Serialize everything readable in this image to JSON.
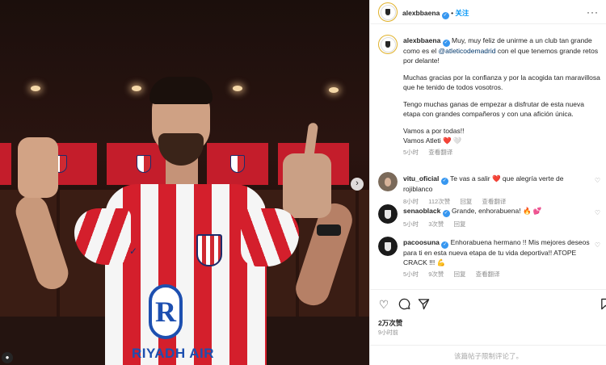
{
  "post": {
    "author": "alexbbaena",
    "follow_label": "关注",
    "more_label": "···",
    "next_label": "›",
    "tag_label": "●"
  },
  "caption": {
    "author": "alexbbaena",
    "para1_a": " Muy, muy feliz de unirme a un club tan grande como es el ",
    "mention": "@atleticodemadrid",
    "para1_b": " con el que tenemos grande retos por delante!",
    "para2": "Muchas gracias por la confianza y por la acogida tan maravillosa que he tenido de todos vosotros.",
    "para3": "Tengo muchas ganas de empezar a disfrutar de esta nueva etapa con grandes compañeros y con una afición única.",
    "para4_line1": "Vamos a por todas!!",
    "para4_line2": "Vamos Atleti ❤️ 🤍",
    "time": "5小时",
    "translate": "查看翻译"
  },
  "comments": [
    {
      "user": "vitu_oficial",
      "text": " Te vas a salir ❤️ que alegría verte de rojiblanco",
      "time": "8小时",
      "likes": "112次赞",
      "reply": "回复",
      "translate": "查看翻译"
    },
    {
      "user": "senaoblack",
      "text": " Grande, enhorabuena! 🔥 💕",
      "time": "5小时",
      "likes": "3次赞",
      "reply": "回复",
      "translate": "查看翻译"
    },
    {
      "user": "pacoosuna",
      "text": " Enhorabuena hermano !! Mis mejores deseos para ti en esta nueva etapa de tu vida deportiva!! ATOPE CRACK !!! 💪",
      "time": "5小时",
      "likes": "9次赞",
      "reply": "回复",
      "translate": "查看翻译"
    }
  ],
  "actions": {
    "likes_count": "2万次赞",
    "post_time": "9小时前",
    "comments_restricted": "该篇帖子限制评论了。"
  },
  "photo": {
    "sponsor_letter": "R",
    "sponsor_text": "RIYADH AIR",
    "kit_brand": "✓"
  },
  "colors": {
    "accent": "#0095f6",
    "verified": "#3797f0",
    "mention": "#00376b",
    "meta": "#8e8e8e",
    "jersey_red": "#d41f2c"
  },
  "icons": [
    "verified-badge-icon",
    "more-options-icon",
    "heart-icon",
    "comment-icon",
    "share-icon",
    "bookmark-icon",
    "next-image-icon",
    "tagged-users-icon"
  ]
}
